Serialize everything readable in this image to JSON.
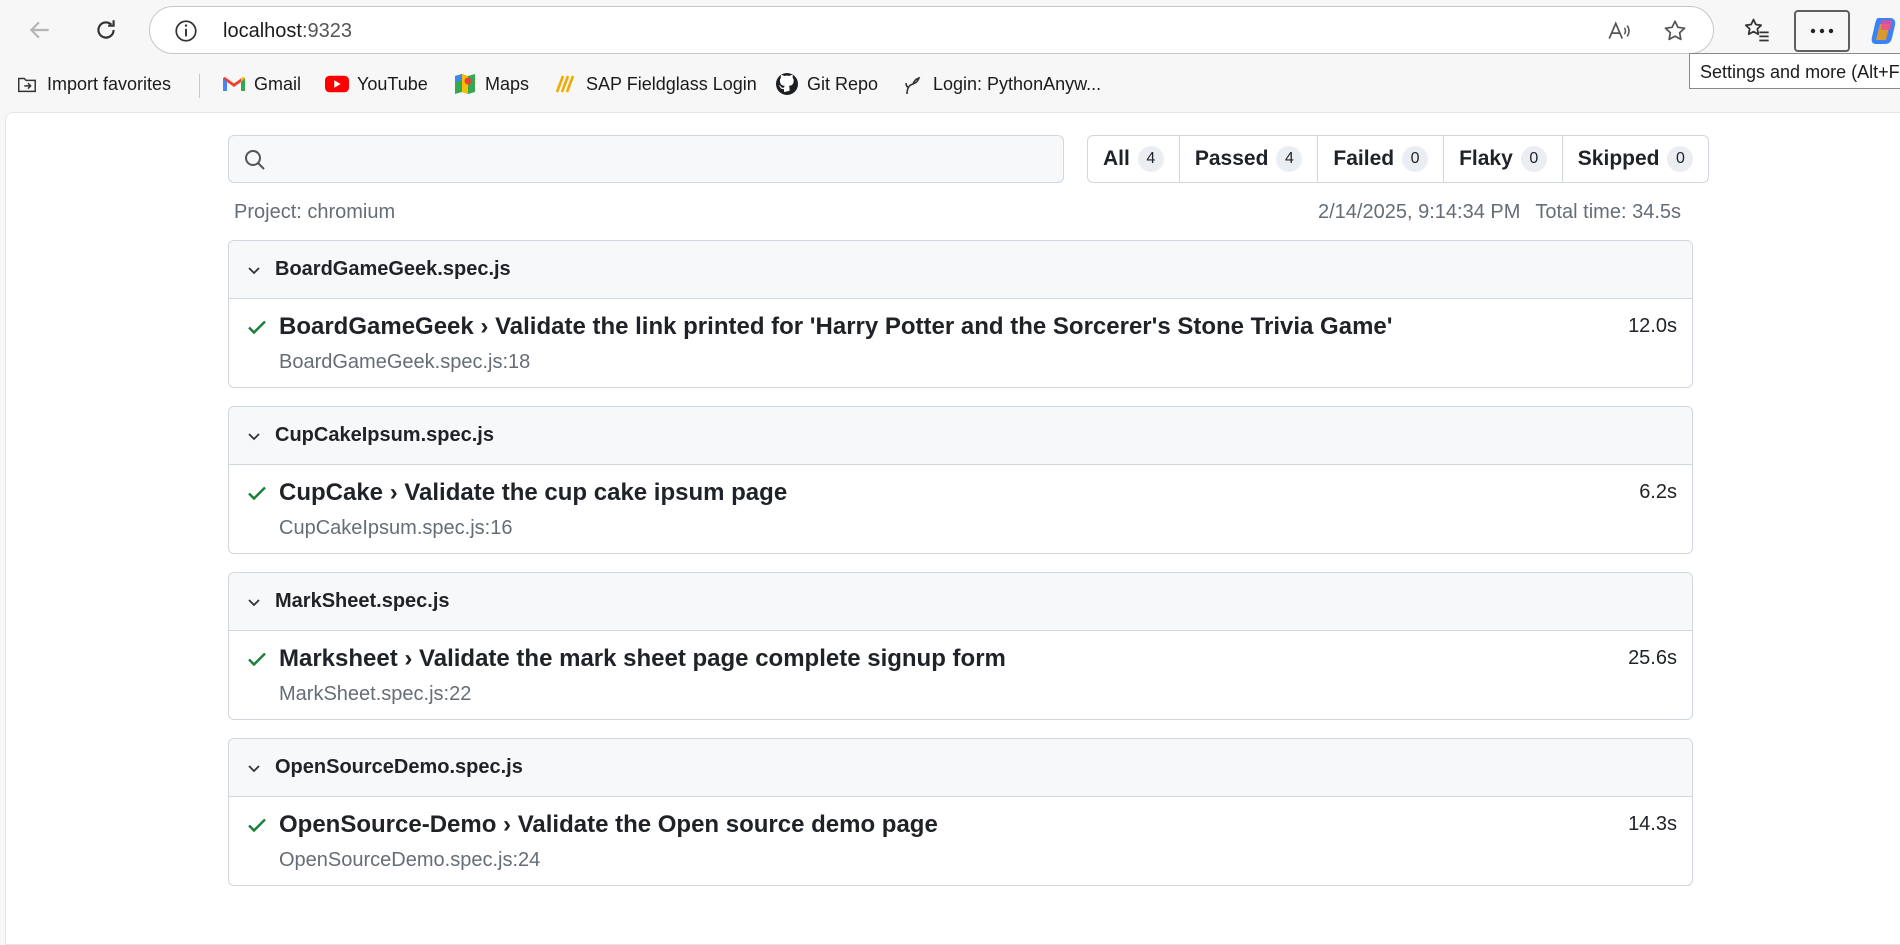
{
  "browser": {
    "url_host": "localhost",
    "url_port": ":9323",
    "tooltip": "Settings and more (Alt+F)",
    "bookmarks": [
      "Import favorites",
      "Gmail",
      "YouTube",
      "Maps",
      "SAP Fieldglass Login",
      "Git Repo",
      "Login: PythonAnyw..."
    ]
  },
  "report": {
    "search": {
      "placeholder": "",
      "value": ""
    },
    "filters": [
      {
        "label": "All",
        "count": "4"
      },
      {
        "label": "Passed",
        "count": "4"
      },
      {
        "label": "Failed",
        "count": "0"
      },
      {
        "label": "Flaky",
        "count": "0"
      },
      {
        "label": "Skipped",
        "count": "0"
      }
    ],
    "project": "Project: chromium",
    "datetime": "2/14/2025, 9:14:34 PM",
    "total_time": "Total time: 34.5s",
    "files": [
      {
        "name": "BoardGameGeek.spec.js",
        "test": "BoardGameGeek › Validate the link printed for 'Harry Potter and the Sorcerer's Stone Trivia Game'",
        "location": "BoardGameGeek.spec.js:18",
        "duration": "12.0s",
        "status": "passed"
      },
      {
        "name": "CupCakeIpsum.spec.js",
        "test": "CupCake › Validate the cup cake ipsum page",
        "location": "CupCakeIpsum.spec.js:16",
        "duration": "6.2s",
        "status": "passed"
      },
      {
        "name": "MarkSheet.spec.js",
        "test": "Marksheet › Validate the mark sheet page complete signup form",
        "location": "MarkSheet.spec.js:22",
        "duration": "25.6s",
        "status": "passed"
      },
      {
        "name": "OpenSourceDemo.spec.js",
        "test": "OpenSource-Demo › Validate the Open source demo page",
        "location": "OpenSourceDemo.spec.js:24",
        "duration": "14.3s",
        "status": "passed"
      }
    ]
  },
  "colors": {
    "passed": "#1a7f37",
    "muted": "#656d76",
    "border": "#d0d7de"
  }
}
